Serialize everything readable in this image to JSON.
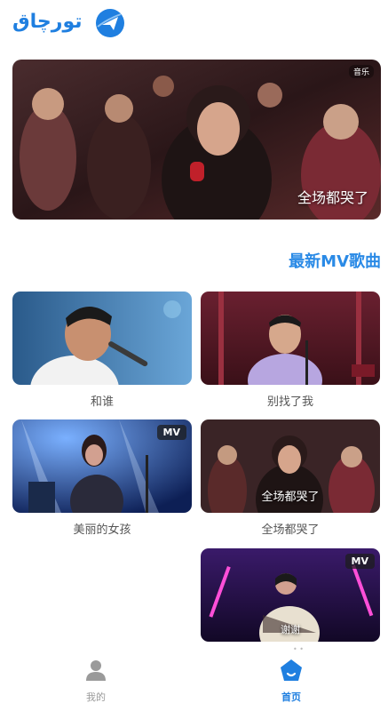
{
  "app": {
    "logo_text": "تورچاق",
    "logo_icon": "airplane-in-circle-logo",
    "accent_color": "#1f7fe0"
  },
  "banner": {
    "caption": "全场都哭了",
    "badge": "音乐"
  },
  "section": {
    "title": "最新MV歌曲"
  },
  "mv_list": [
    {
      "title": "和谁",
      "badge": ""
    },
    {
      "title": "别找了我",
      "badge": ""
    },
    {
      "title": "美丽的女孩",
      "badge": "MV"
    },
    {
      "title": "全场都哭了",
      "badge": "",
      "overlay": "全场都哭了"
    },
    {
      "title": "",
      "badge": "MV",
      "overlay": "谢谢"
    }
  ],
  "tabbar": {
    "mine_label": "我的",
    "home_label": "首页",
    "mine_icon": "user-icon",
    "home_icon": "home-pentagon-icon",
    "active": "home"
  }
}
